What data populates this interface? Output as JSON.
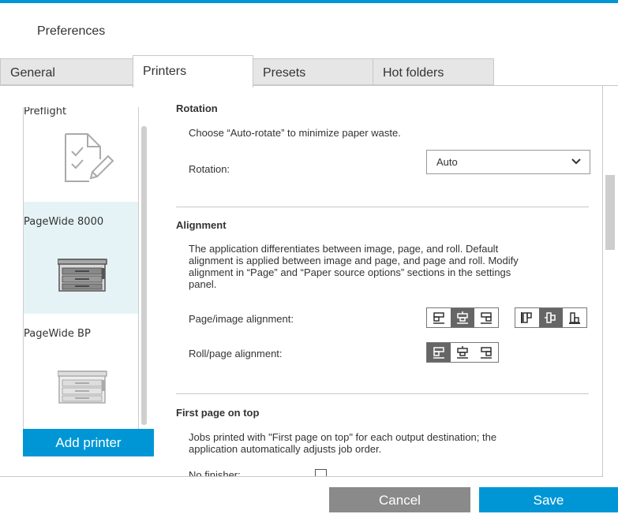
{
  "window": {
    "title": "Preferences"
  },
  "tabs": [
    {
      "label": "General"
    },
    {
      "label": "Printers"
    },
    {
      "label": "Presets"
    },
    {
      "label": "Hot folders"
    }
  ],
  "active_tab": "Printers",
  "printers": [
    {
      "name": "Preflight",
      "icon": "document-check-icon"
    },
    {
      "name": "PageWide 8000",
      "icon": "printer-icon",
      "selected": true
    },
    {
      "name": "PageWide BP",
      "icon": "printer-icon"
    }
  ],
  "add_printer_label": "Add printer",
  "rotation": {
    "heading": "Rotation",
    "description": "Choose “Auto-rotate” to minimize paper waste.",
    "label": "Rotation:",
    "value": "Auto"
  },
  "alignment": {
    "heading": "Alignment",
    "description_lines": [
      "The application differentiates between image, page, and roll. Default",
      "alignment is applied between image and page, and page and roll. Modify",
      "alignment in “Page” and “Paper source options” sections in the settings",
      "panel."
    ],
    "page_image_label": "Page/image alignment:",
    "roll_page_label": "Roll/page alignment:",
    "page_image_horizontal_selected": "center",
    "page_image_vertical_selected": "center",
    "roll_page_selected": "left"
  },
  "first_page": {
    "heading": "First page on top",
    "description_lines": [
      "Jobs printed with \"First page on top\" for each output destination; the",
      "application automatically adjusts job order."
    ],
    "no_finisher_label": "No finisher:",
    "no_finisher_checked": false
  },
  "buttons": {
    "cancel": "Cancel",
    "save": "Save"
  },
  "colors": {
    "accent": "#0096d6",
    "selected_bg": "#e5f3f6",
    "cancel_bg": "#8a8a8a"
  }
}
